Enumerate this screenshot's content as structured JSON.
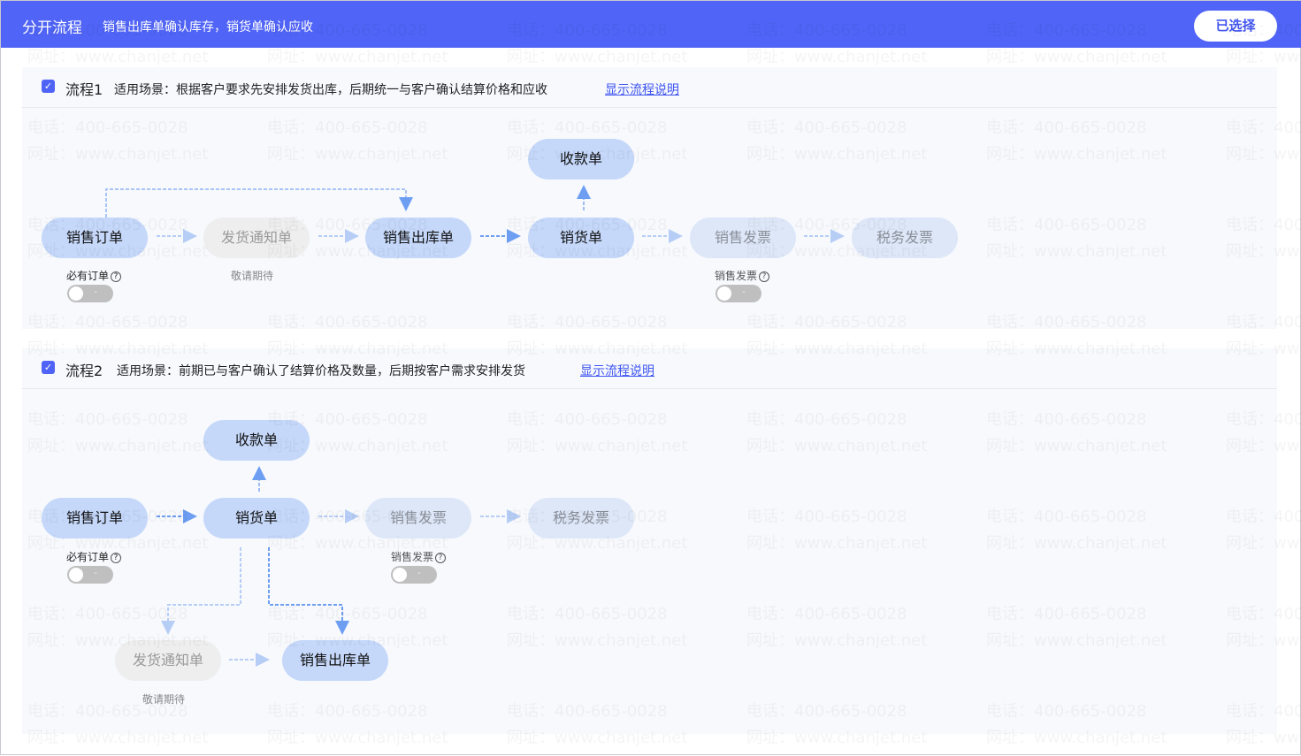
{
  "header": {
    "title": "分开流程",
    "subtitle": "销售出库单确认库存，销货单确认应收",
    "selected_button": "已选择"
  },
  "watermark": {
    "phone": "电话：400-665-0028",
    "site": "网址：www.chanjet.net"
  },
  "flow1": {
    "name": "流程1",
    "desc": "适用场景：根据客户要求先安排发货出库，后期统一与客户确认结算价格和应收",
    "link": "显示流程说明",
    "checked": true,
    "nodes": {
      "order": "销售订单",
      "notice": "发货通知单",
      "outbound": "销售出库单",
      "sales": "销货单",
      "receipt": "收款单",
      "invoice": "销售发票",
      "tax": "税务发票"
    },
    "order_toggle_label": "必有订单",
    "notice_note": "敬请期待",
    "invoice_toggle_label": "销售发票",
    "order_toggle_on": false,
    "invoice_toggle_on": false
  },
  "flow2": {
    "name": "流程2",
    "desc": "适用场景：前期已与客户确认了结算价格及数量，后期按客户需求安排发货",
    "link": "显示流程说明",
    "checked": true,
    "nodes": {
      "order": "销售订单",
      "sales": "销货单",
      "receipt": "收款单",
      "invoice": "销售发票",
      "tax": "税务发票",
      "notice": "发货通知单",
      "outbound": "销售出库单"
    },
    "order_toggle_label": "必有订单",
    "notice_note": "敬请期待",
    "invoice_toggle_label": "销售发票",
    "order_toggle_on": false,
    "invoice_toggle_on": false
  },
  "colors": {
    "accent": "#5064f7",
    "node": "#c5d8fa",
    "arrow": "#5b8ff0"
  }
}
